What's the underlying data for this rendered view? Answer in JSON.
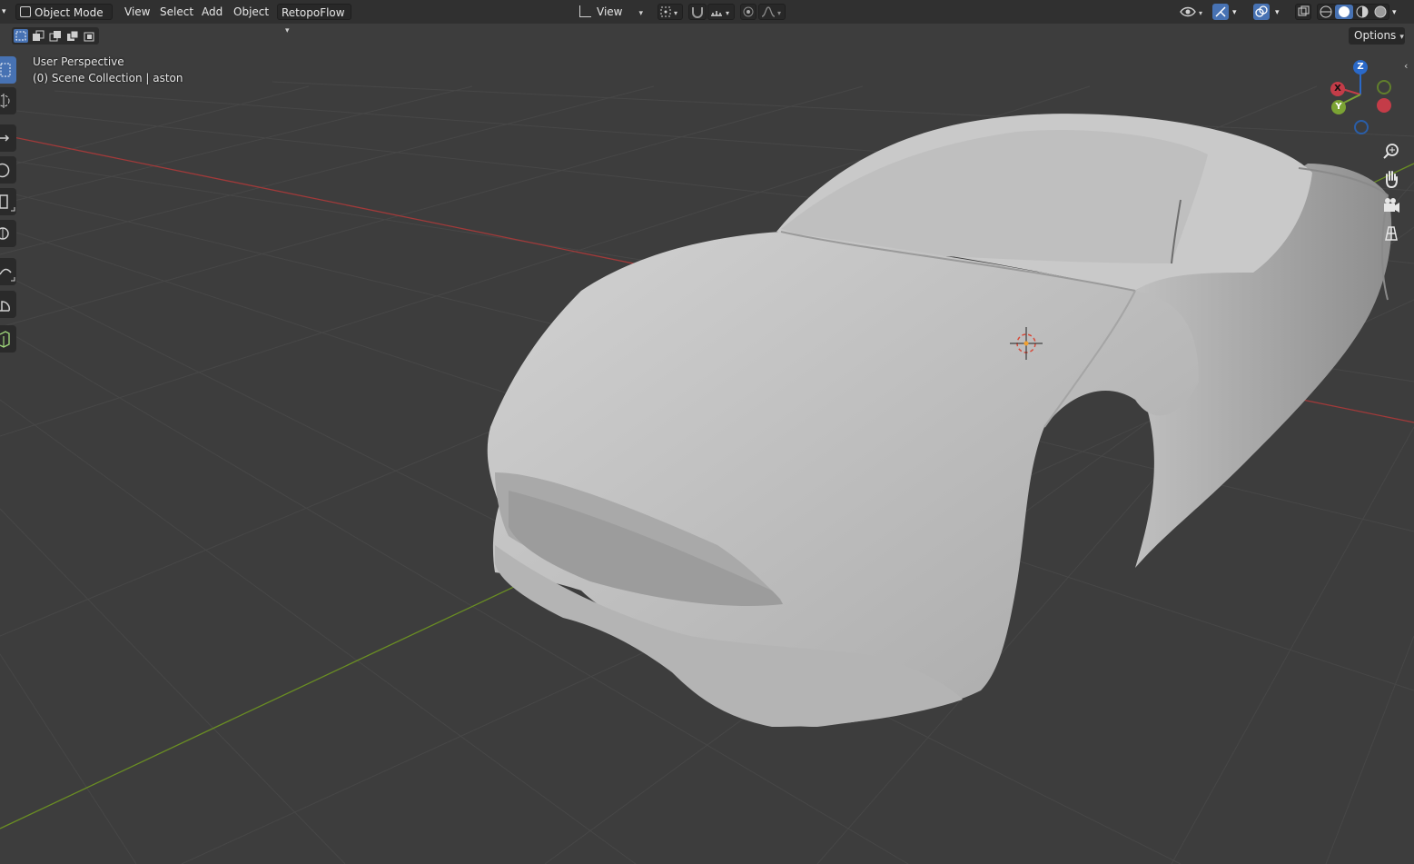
{
  "header": {
    "mode_label": "Object Mode",
    "menus": [
      "View",
      "Select",
      "Add",
      "Object"
    ],
    "addon_label": "RetopoFlow",
    "transform_orientation_label": "View"
  },
  "toolbar_right": {
    "options_label": "Options"
  },
  "overlay": {
    "perspective_label": "User Perspective",
    "collection_label": "(0) Scene Collection | aston"
  },
  "gizmo": {
    "z_label": "Z",
    "x_label": "X",
    "y_label": "Y"
  },
  "colors": {
    "header_bg": "#303030",
    "viewport_bg": "#3d3d3d",
    "grid_line": "#4a4a4a",
    "axis_x": "#a13a3a",
    "axis_y": "#6a8e23",
    "active_blue": "#4772b3",
    "mesh_light": "#c4c4c4"
  },
  "icons": {
    "select_box": "select-box-icon",
    "cursor": "cursor-icon",
    "move": "move-icon",
    "rotate": "rotate-icon",
    "scale": "scale-icon",
    "transform": "transform-icon",
    "annotate": "annotate-icon",
    "measure": "measure-icon",
    "add_cube": "add-cube-icon",
    "zoom": "zoom-icon",
    "pan": "hand-icon",
    "camera": "camera-icon",
    "ortho": "grid-icon"
  }
}
